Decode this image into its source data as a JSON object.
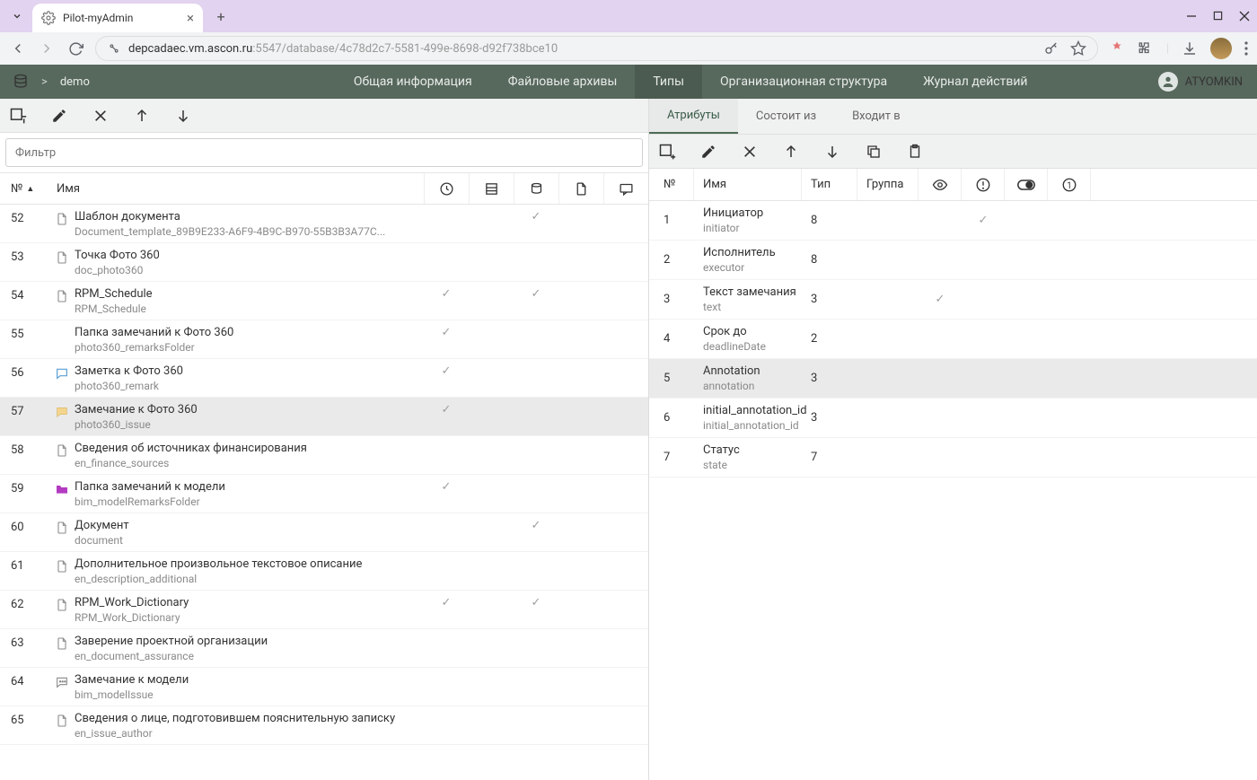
{
  "browser": {
    "tab_title": "Pilot-myAdmin",
    "url_part1": "depcadaec.vm.ascon.ru",
    "url_part2": ":5547/database/4c78d2c7-5581-499e-8698-d92f738bce10"
  },
  "header": {
    "breadcrumb": "demo",
    "nav": [
      "Общая информация",
      "Файловые архивы",
      "Типы",
      "Организационная структура",
      "Журнал действий"
    ],
    "user": "ATYOMKIN"
  },
  "left": {
    "filter_placeholder": "Фильтр",
    "cols": {
      "num": "№",
      "name": "Имя"
    },
    "rows": [
      {
        "n": "52",
        "t": "Шаблон документа",
        "s": "Document_template_89B9E233-A6F9-4B9C-B970-55B3B3A77C...",
        "icon": "doc",
        "c": [
          false,
          false,
          true,
          false,
          false
        ]
      },
      {
        "n": "53",
        "t": "Точка Фото 360",
        "s": "doc_photo360",
        "icon": "doc",
        "c": [
          false,
          false,
          false,
          false,
          false
        ]
      },
      {
        "n": "54",
        "t": "RPM_Schedule",
        "s": "RPM_Schedule",
        "icon": "doc",
        "c": [
          true,
          false,
          true,
          false,
          false
        ]
      },
      {
        "n": "55",
        "t": "Папка замечаний к Фото 360",
        "s": "photo360_remarksFolder",
        "icon": "none",
        "c": [
          true,
          false,
          false,
          false,
          false
        ]
      },
      {
        "n": "56",
        "t": "Заметка к Фото 360",
        "s": "photo360_remark",
        "icon": "chat-blue",
        "c": [
          true,
          false,
          false,
          false,
          false
        ]
      },
      {
        "n": "57",
        "t": "Замечание к Фото 360",
        "s": "photo360_issue",
        "icon": "chat-yellow",
        "c": [
          true,
          false,
          false,
          false,
          false
        ],
        "sel": true
      },
      {
        "n": "58",
        "t": "Сведения об источниках финансирования",
        "s": "en_finance_sources",
        "icon": "doc",
        "c": [
          false,
          false,
          false,
          false,
          false
        ]
      },
      {
        "n": "59",
        "t": "Папка замечаний к модели",
        "s": "bim_modelRemarksFolder",
        "icon": "folder-purple",
        "c": [
          true,
          false,
          false,
          false,
          false
        ]
      },
      {
        "n": "60",
        "t": "Документ",
        "s": "document",
        "icon": "doc",
        "c": [
          false,
          false,
          true,
          false,
          false
        ]
      },
      {
        "n": "61",
        "t": "Дополнительное произвольное текстовое описание",
        "s": "en_description_additional",
        "icon": "doc",
        "c": [
          false,
          false,
          false,
          false,
          false
        ]
      },
      {
        "n": "62",
        "t": "RPM_Work_Dictionary",
        "s": "RPM_Work_Dictionary",
        "icon": "doc",
        "c": [
          true,
          false,
          true,
          false,
          false
        ]
      },
      {
        "n": "63",
        "t": "Заверение проектной организации",
        "s": "en_document_assurance",
        "icon": "doc",
        "c": [
          false,
          false,
          false,
          false,
          false
        ]
      },
      {
        "n": "64",
        "t": "Замечание к модели",
        "s": "bim_modelIssue",
        "icon": "chat-dots",
        "c": [
          false,
          false,
          false,
          false,
          false
        ]
      },
      {
        "n": "65",
        "t": "Сведения о лице, подготовившем пояснительную записку",
        "s": "en_issue_author",
        "icon": "doc",
        "c": [
          false,
          false,
          false,
          false,
          false
        ]
      }
    ]
  },
  "right": {
    "tabs": [
      "Атрибуты",
      "Состоит из",
      "Входит в"
    ],
    "cols": {
      "num": "№",
      "name": "Имя",
      "type": "Тип",
      "group": "Группа"
    },
    "rows": [
      {
        "n": "1",
        "t": "Инициатор",
        "s": "initiator",
        "type": "8",
        "c": [
          false,
          true,
          false,
          false
        ]
      },
      {
        "n": "2",
        "t": "Исполнитель",
        "s": "executor",
        "type": "8",
        "c": [
          false,
          false,
          false,
          false
        ]
      },
      {
        "n": "3",
        "t": "Текст замечания",
        "s": "text",
        "type": "3",
        "c": [
          true,
          false,
          false,
          false
        ]
      },
      {
        "n": "4",
        "t": "Срок до",
        "s": "deadlineDate",
        "type": "2",
        "c": [
          false,
          false,
          false,
          false
        ]
      },
      {
        "n": "5",
        "t": "Annotation",
        "s": "annotation",
        "type": "3",
        "c": [
          false,
          false,
          false,
          false
        ],
        "sel": true
      },
      {
        "n": "6",
        "t": "initial_annotation_id",
        "s": "initial_annotation_id",
        "type": "3",
        "c": [
          false,
          false,
          false,
          false
        ]
      },
      {
        "n": "7",
        "t": "Статус",
        "s": "state",
        "type": "7",
        "c": [
          false,
          false,
          false,
          false
        ]
      }
    ]
  }
}
